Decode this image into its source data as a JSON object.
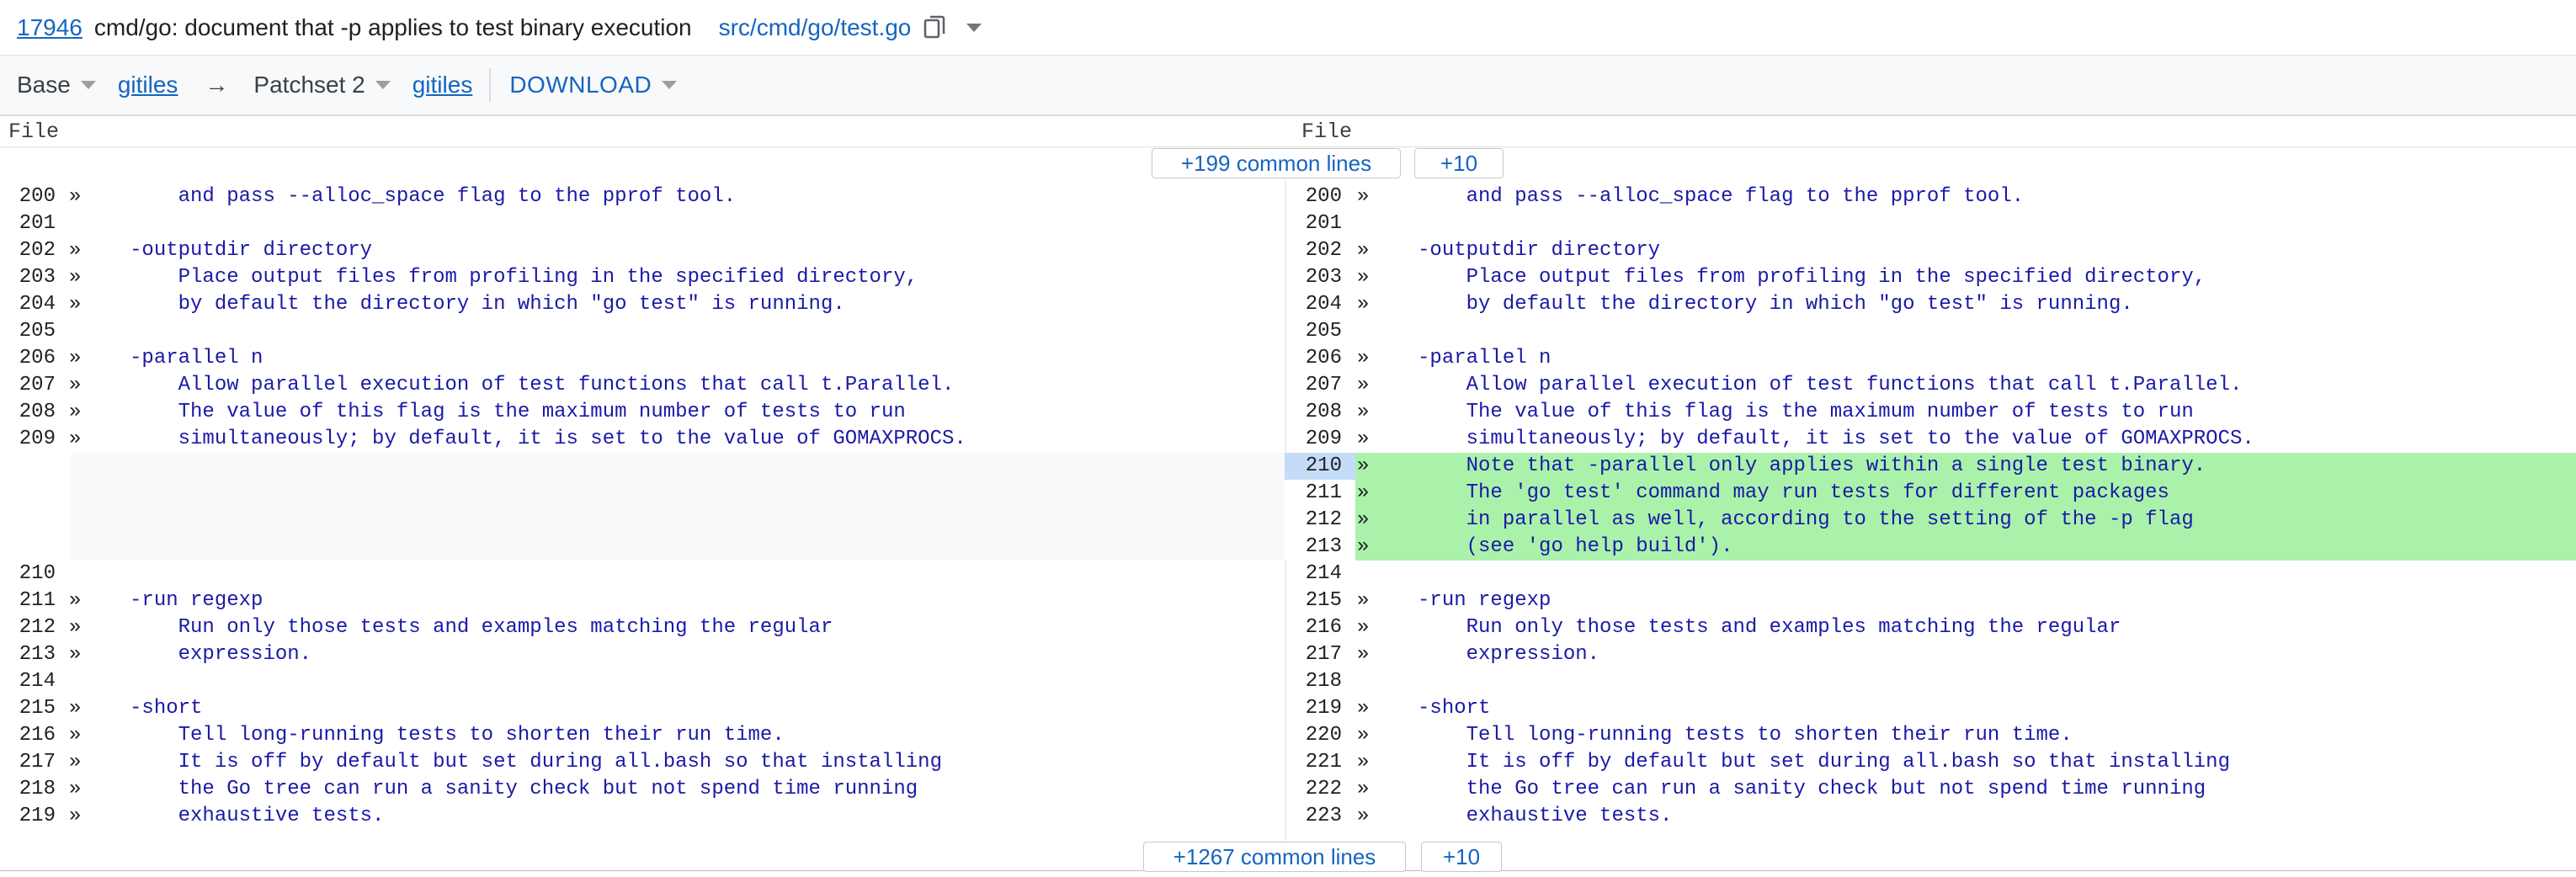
{
  "header": {
    "change_number": "17946",
    "change_title": "cmd/go: document that -p applies to test binary execution",
    "file_path": "src/cmd/go/test.go",
    "copy_icon": "copy-icon",
    "dropdown_icon": "chevron-down-icon"
  },
  "toolbar": {
    "base_label": "Base",
    "base_link": "gitiles",
    "arrow": "→",
    "patchset_label": "Patchset 2",
    "patchset_link": "gitiles",
    "download_label": "DOWNLOAD"
  },
  "diff": {
    "left_header": "File",
    "right_header": "File",
    "top_common": "+199 common lines",
    "top_plus10": "+10",
    "bottom_common": "+1267 common lines",
    "bottom_plus10": "+10",
    "tab_marker": "»",
    "colors": {
      "added_bg": "#aaf2aa",
      "code_text": "#1a1aa6",
      "link": "#1565c0",
      "selected_line": "#c4dcf7"
    },
    "rows": [
      {
        "l_num": "200",
        "l_mark": "»",
        "l_code": "         and pass --alloc_space flag to the pprof tool.",
        "r_num": "200",
        "r_mark": "»",
        "r_code": "         and pass --alloc_space flag to the pprof tool."
      },
      {
        "l_num": "201",
        "l_mark": "",
        "l_code": "",
        "r_num": "201",
        "r_mark": "",
        "r_code": ""
      },
      {
        "l_num": "202",
        "l_mark": "»",
        "l_code": "     -outputdir directory",
        "r_num": "202",
        "r_mark": "»",
        "r_code": "     -outputdir directory"
      },
      {
        "l_num": "203",
        "l_mark": "»",
        "l_code": "         Place output files from profiling in the specified directory,",
        "r_num": "203",
        "r_mark": "»",
        "r_code": "         Place output files from profiling in the specified directory,"
      },
      {
        "l_num": "204",
        "l_mark": "»",
        "l_code": "         by default the directory in which \"go test\" is running.",
        "r_num": "204",
        "r_mark": "»",
        "r_code": "         by default the directory in which \"go test\" is running."
      },
      {
        "l_num": "205",
        "l_mark": "",
        "l_code": "",
        "r_num": "205",
        "r_mark": "",
        "r_code": ""
      },
      {
        "l_num": "206",
        "l_mark": "»",
        "l_code": "     -parallel n",
        "r_num": "206",
        "r_mark": "»",
        "r_code": "     -parallel n"
      },
      {
        "l_num": "207",
        "l_mark": "»",
        "l_code": "         Allow parallel execution of test functions that call t.Parallel.",
        "r_num": "207",
        "r_mark": "»",
        "r_code": "         Allow parallel execution of test functions that call t.Parallel."
      },
      {
        "l_num": "208",
        "l_mark": "»",
        "l_code": "         The value of this flag is the maximum number of tests to run",
        "r_num": "208",
        "r_mark": "»",
        "r_code": "         The value of this flag is the maximum number of tests to run"
      },
      {
        "l_num": "209",
        "l_mark": "»",
        "l_code": "         simultaneously; by default, it is set to the value of GOMAXPROCS.",
        "r_num": "209",
        "r_mark": "»",
        "r_code": "         simultaneously; by default, it is set to the value of GOMAXPROCS."
      },
      {
        "l_num": "",
        "l_mark": "",
        "l_code": "",
        "r_num": "210",
        "r_mark": "»",
        "r_code": "         Note that -parallel only applies within a single test binary.",
        "added": true,
        "active": true
      },
      {
        "l_num": "",
        "l_mark": "",
        "l_code": "",
        "r_num": "211",
        "r_mark": "»",
        "r_code": "         The 'go test' command may run tests for different packages",
        "added": true
      },
      {
        "l_num": "",
        "l_mark": "",
        "l_code": "",
        "r_num": "212",
        "r_mark": "»",
        "r_code": "         in parallel as well, according to the setting of the -p flag",
        "added": true
      },
      {
        "l_num": "",
        "l_mark": "",
        "l_code": "",
        "r_num": "213",
        "r_mark": "»",
        "r_code": "         (see 'go help build').",
        "added": true
      },
      {
        "l_num": "210",
        "l_mark": "",
        "l_code": "",
        "r_num": "214",
        "r_mark": "",
        "r_code": ""
      },
      {
        "l_num": "211",
        "l_mark": "»",
        "l_code": "     -run regexp",
        "r_num": "215",
        "r_mark": "»",
        "r_code": "     -run regexp"
      },
      {
        "l_num": "212",
        "l_mark": "»",
        "l_code": "         Run only those tests and examples matching the regular",
        "r_num": "216",
        "r_mark": "»",
        "r_code": "         Run only those tests and examples matching the regular"
      },
      {
        "l_num": "213",
        "l_mark": "»",
        "l_code": "         expression.",
        "r_num": "217",
        "r_mark": "»",
        "r_code": "         expression."
      },
      {
        "l_num": "214",
        "l_mark": "",
        "l_code": "",
        "r_num": "218",
        "r_mark": "",
        "r_code": ""
      },
      {
        "l_num": "215",
        "l_mark": "»",
        "l_code": "     -short",
        "r_num": "219",
        "r_mark": "»",
        "r_code": "     -short"
      },
      {
        "l_num": "216",
        "l_mark": "»",
        "l_code": "         Tell long-running tests to shorten their run time.",
        "r_num": "220",
        "r_mark": "»",
        "r_code": "         Tell long-running tests to shorten their run time."
      },
      {
        "l_num": "217",
        "l_mark": "»",
        "l_code": "         It is off by default but set during all.bash so that installing",
        "r_num": "221",
        "r_mark": "»",
        "r_code": "         It is off by default but set during all.bash so that installing"
      },
      {
        "l_num": "218",
        "l_mark": "»",
        "l_code": "         the Go tree can run a sanity check but not spend time running",
        "r_num": "222",
        "r_mark": "»",
        "r_code": "         the Go tree can run a sanity check but not spend time running"
      },
      {
        "l_num": "219",
        "l_mark": "»",
        "l_code": "         exhaustive tests.",
        "r_num": "223",
        "r_mark": "»",
        "r_code": "         exhaustive tests."
      }
    ]
  }
}
